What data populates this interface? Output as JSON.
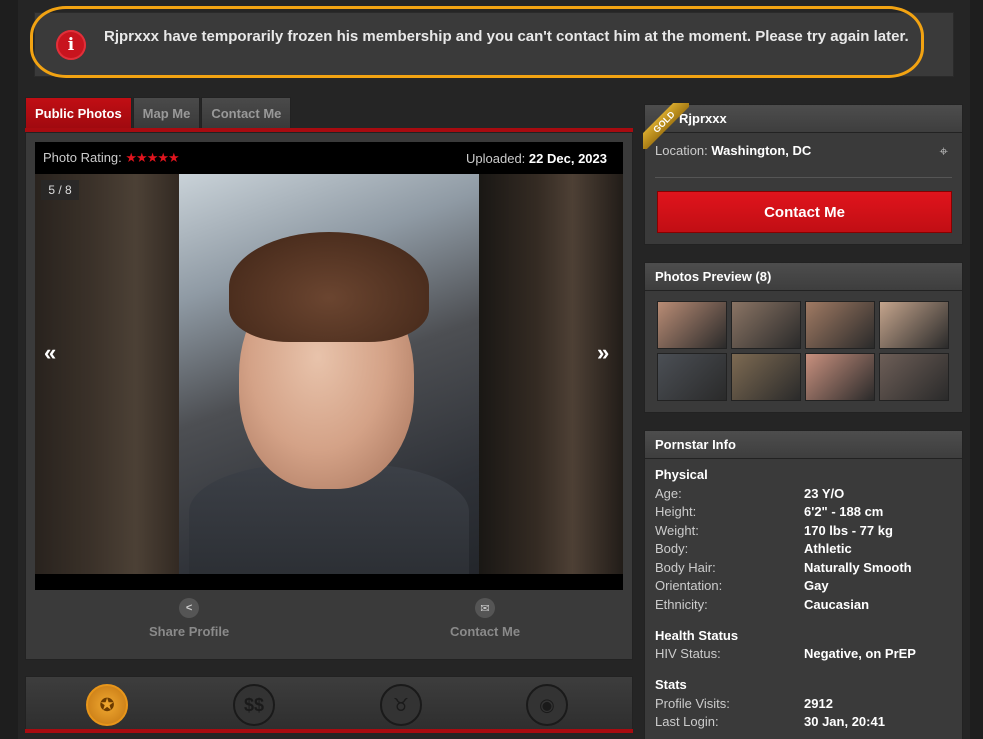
{
  "alert": {
    "icon": "info-icon",
    "message": "Rjprxxx have temporarily frozen his membership and you can't contact him at the moment. Please try again later."
  },
  "tabs": [
    {
      "label": "Public Photos",
      "active": true
    },
    {
      "label": "Map Me",
      "active": false
    },
    {
      "label": "Contact Me",
      "active": false
    }
  ],
  "photo": {
    "rating_label": "Photo Rating:",
    "rating_stars": "★★★★★",
    "uploaded_label": "Uploaded:",
    "uploaded_value": "22 Dec, 2023",
    "counter": "5 / 8",
    "prev": "«",
    "next": "»"
  },
  "actions": {
    "share": "Share Profile",
    "contact": "Contact Me"
  },
  "bottom_nav": [
    {
      "icon": "award-badge-icon",
      "active": true
    },
    {
      "icon": "dollar-icon",
      "active": false
    },
    {
      "icon": "devil-icon",
      "active": false
    },
    {
      "icon": "camera-icon",
      "active": false
    }
  ],
  "profile": {
    "badge": "GOLD",
    "username": "Rjprxxx",
    "location_label": "Location:",
    "location_value": "Washington, DC",
    "contact_button": "Contact Me"
  },
  "photos_preview": {
    "title": "Photos Preview (8)",
    "colors": [
      "#b98c75",
      "#8a7464",
      "#a07a63",
      "#c4a48c",
      "#4b4f55",
      "#7d6a52",
      "#c8907e",
      "#6d5e57"
    ]
  },
  "pornstar_info": {
    "title": "Pornstar Info",
    "physical_title": "Physical",
    "physical": [
      {
        "k": "Age:",
        "v": "23 Y/O"
      },
      {
        "k": "Height:",
        "v": "6'2\" - 188 cm"
      },
      {
        "k": "Weight:",
        "v": "170 lbs - 77 kg"
      },
      {
        "k": "Body:",
        "v": "Athletic"
      },
      {
        "k": "Body Hair:",
        "v": "Naturally Smooth"
      },
      {
        "k": "Orientation:",
        "v": "Gay"
      },
      {
        "k": "Ethnicity:",
        "v": "Caucasian"
      }
    ],
    "health_title": "Health Status",
    "health": [
      {
        "k": "HIV Status:",
        "v": "Negative, on PrEP"
      }
    ],
    "stats_title": "Stats",
    "stats": [
      {
        "k": "Profile Visits:",
        "v": "2912"
      },
      {
        "k": "Last Login:",
        "v": "30 Jan, 20:41"
      }
    ]
  }
}
